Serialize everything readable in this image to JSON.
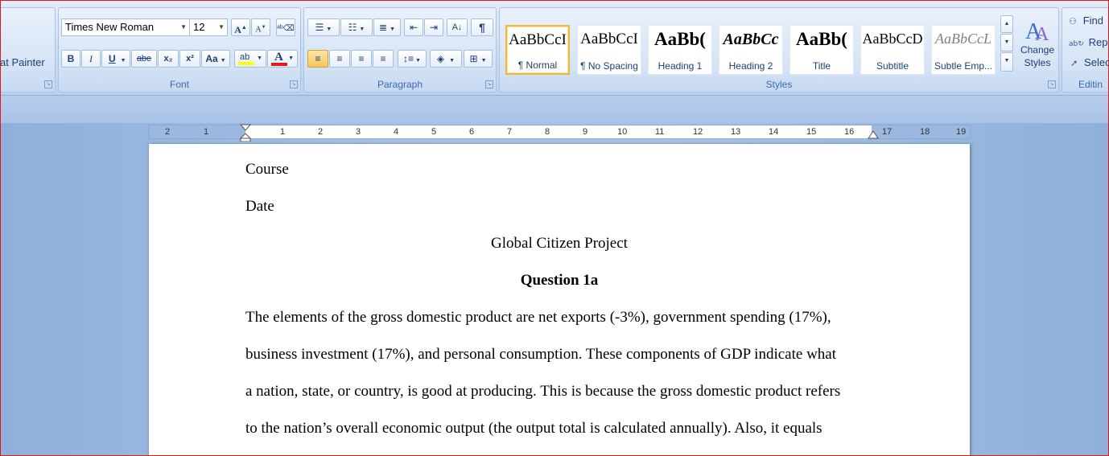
{
  "ribbon": {
    "clipboard": {
      "format_painter": "at Painter"
    },
    "font": {
      "label": "Font",
      "font_name": "Times New Roman",
      "font_size": "12",
      "grow": "A",
      "shrink": "A",
      "bold": "B",
      "italic": "I",
      "underline": "U",
      "strike": "abe",
      "subscript": "x₂",
      "superscript": "x²",
      "change_case": "Aa",
      "highlight": "ab",
      "font_color": "A"
    },
    "paragraph": {
      "label": "Paragraph",
      "show_marks": "¶"
    },
    "styles": {
      "label": "Styles",
      "tiles": [
        {
          "sample": "AaBbCcI",
          "name": "¶ Normal"
        },
        {
          "sample": "AaBbCcI",
          "name": "¶ No Spacing"
        },
        {
          "sample": "AaBb(",
          "name": "Heading 1"
        },
        {
          "sample": "AaBbCc",
          "name": "Heading 2"
        },
        {
          "sample": "AaBb(",
          "name": "Title"
        },
        {
          "sample": "AaBbCcD",
          "name": "Subtitle"
        },
        {
          "sample": "AaBbCcL",
          "name": "Subtle Emp..."
        }
      ],
      "change_styles": "Change Styles"
    },
    "editing": {
      "label": "Editin",
      "find": "Find",
      "replace": "Repl",
      "select": "Selec"
    }
  },
  "ruler": {
    "left_labels": [
      "2",
      "1"
    ],
    "right_labels": [
      "1",
      "2",
      "3",
      "4",
      "5",
      "6",
      "7",
      "8",
      "9",
      "10",
      "11",
      "12",
      "13",
      "14",
      "15",
      "16",
      "17",
      "18",
      "19"
    ]
  },
  "document": {
    "lines": [
      "Course",
      "Date",
      "Global Citizen Project",
      "Question 1a",
      "The elements of the gross domestic product are net exports (-3%), government spending (17%),",
      "business investment (17%), and personal consumption. These components of GDP indicate what",
      "a nation, state, or country, is good at producing. This is because the gross domestic product refers",
      "to the nation’s overall economic output (the output total is calculated annually). Also, it equals"
    ]
  },
  "colors": {
    "frame_border": "#e0161a",
    "selected_style": "#f0b73a",
    "font_color_bar": "#e31b1b",
    "highlight_bar": "#ffff00"
  }
}
